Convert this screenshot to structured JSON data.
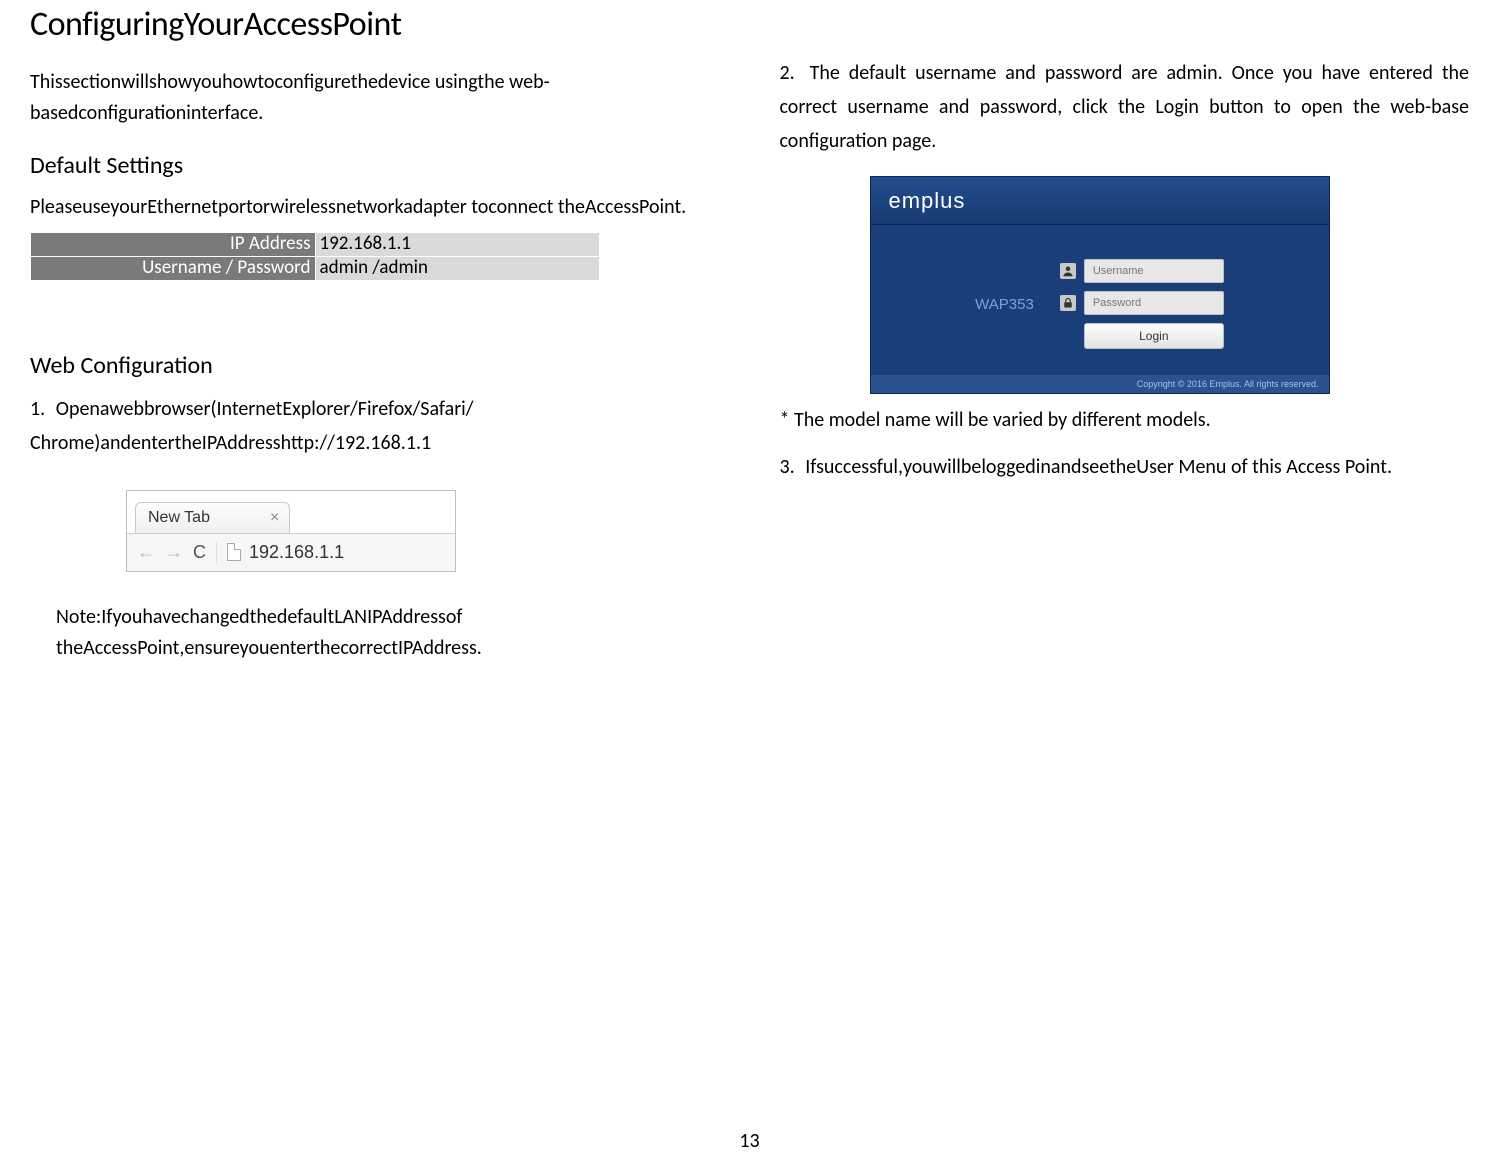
{
  "title": "ConfiguringYourAccessPoint",
  "intro": "Thissectionwillshowyouhowtoconfigurethedevice usingthe web-basedconfigurationinterface.",
  "default_heading": "Default Settings",
  "default_text": "PleaseuseyourEthernetportorwirelessnetworkadapter toconnect theAccessPoint.",
  "settings": {
    "ip_label": "IP Address",
    "ip_value": "192.168.1.1",
    "cred_label": "Username / Password",
    "cred_value": "admin /admin"
  },
  "webconf_heading": "Web Configuration",
  "step1_num": "1.",
  "step1": "Openawebbrowser(InternetExplorer/Firefox/Safari/ Chrome)andentertheIPAddresshttp://192.168.1.1",
  "browser": {
    "tab_label": "New Tab",
    "close": "×",
    "back": "←",
    "forward": "→",
    "reload": "C",
    "address": "192.168.1.1"
  },
  "note": "Note:IfyouhavechangedthedefaultLANIPAddressof theAccessPoint,ensureyouenterthecorrectIPAddress.",
  "step2_num": "2.",
  "step2": "The default username and password are admin. Once you have entered the correct username and password, click the Login button to open the web-base configuration page.",
  "login": {
    "brand": "emplus",
    "model": "WAP353",
    "username_ph": "Username",
    "password_ph": "Password",
    "login_btn": "Login",
    "footer": "Copyright © 2016 Emplus. All rights reserved."
  },
  "asterisk": "* The model name will be varied by different models.",
  "step3_num": "3.",
  "step3": "Ifsuccessful,youwillbeloggedinandseetheUser Menu of this Access Point.",
  "page_number": "13"
}
